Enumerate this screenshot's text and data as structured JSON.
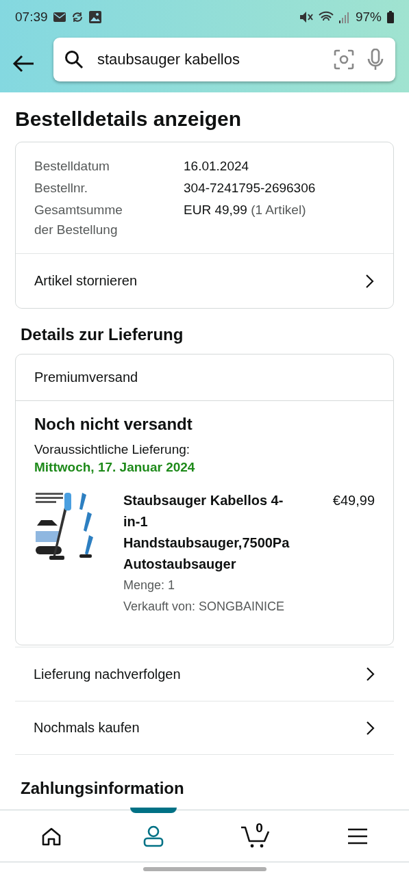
{
  "status_bar": {
    "time": "07:39",
    "battery": "97%"
  },
  "search": {
    "value": "staubsauger kabellos"
  },
  "title": "Bestelldetails anzeigen",
  "order_summary": {
    "fields": [
      {
        "label": "Bestelldatum",
        "value": "16.01.2024"
      },
      {
        "label": "Bestellnr.",
        "value": "304-7241795-2696306"
      },
      {
        "label": "Gesamtsumme der Bestellung",
        "value": "EUR 49,99",
        "note": "(1 Artikel)"
      }
    ],
    "action": "Artikel stornieren"
  },
  "delivery": {
    "heading": "Details zur Lieferung",
    "shipping": "Premiumversand",
    "status": "Noch nicht versandt",
    "eta_label": "Voraussichtliche Lieferung:",
    "eta": "Mittwoch, 17. Januar 2024",
    "item": {
      "kind": "picture",
      "name": "Staubsauger Kabellos 4-in-1 Handstaubsauger,7500Pa Autostaubsauger",
      "price": "€49,99",
      "quantity": "Menge: 1",
      "seller": "Verkauft von: SONGBAINICE"
    }
  },
  "actions": [
    "Lieferung nachverfolgen",
    "Nochmals kaufen"
  ],
  "next_heading": "Zahlungsinformation",
  "bottom_nav": [
    {
      "kind": "home",
      "selected": false
    },
    {
      "kind": "account",
      "selected": true
    },
    {
      "kind": "cart",
      "selected": false,
      "count": "0"
    },
    {
      "kind": "menu",
      "selected": false
    }
  ]
}
